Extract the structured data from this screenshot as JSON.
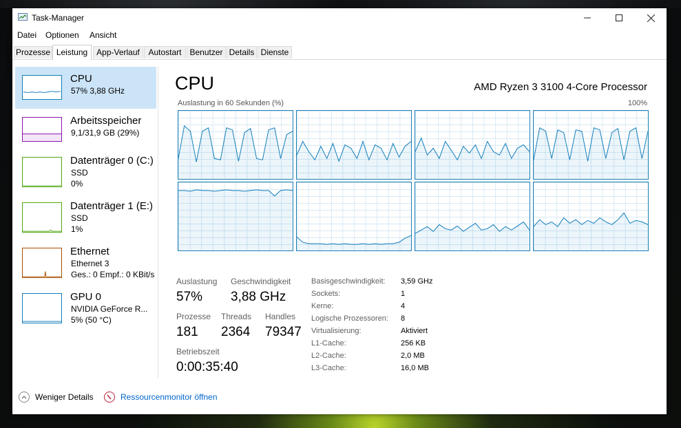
{
  "window": {
    "title": "Task-Manager"
  },
  "menu": [
    "Datei",
    "Optionen",
    "Ansicht"
  ],
  "tabs": [
    "Prozesse",
    "Leistung",
    "App-Verlauf",
    "Autostart",
    "Benutzer",
    "Details",
    "Dienste"
  ],
  "active_tab": "Leistung",
  "sidebar": [
    {
      "title": "CPU",
      "sub1": "57%  3,88 GHz",
      "sub2": "",
      "color": "#117dbb",
      "selected": true
    },
    {
      "title": "Arbeitsspeicher",
      "sub1": "9,1/31,9 GB (29%)",
      "sub2": "",
      "color": "#8b12ae",
      "selected": false
    },
    {
      "title": "Datenträger 0 (C:)",
      "sub1": "SSD",
      "sub2": "0%",
      "color": "#4da60c",
      "selected": false
    },
    {
      "title": "Datenträger 1 (E:)",
      "sub1": "SSD",
      "sub2": "1%",
      "color": "#4da60c",
      "selected": false
    },
    {
      "title": "Ethernet",
      "sub1": "Ethernet 3",
      "sub2": "Ges.: 0  Empf.: 0 KBit/s",
      "color": "#a74f01",
      "selected": false
    },
    {
      "title": "GPU 0",
      "sub1": "NVIDIA GeForce R...",
      "sub2": "5%  (50 °C)",
      "color": "#117dbb",
      "selected": false
    }
  ],
  "main": {
    "title": "CPU",
    "model": "AMD Ryzen 3 3100 4-Core Processor",
    "axis_label": "Auslastung in 60 Sekunden (%)",
    "axis_max": "100%"
  },
  "core_utilization_percent": [
    [
      30,
      78,
      70,
      25,
      70,
      75,
      30,
      28,
      75,
      72,
      26,
      68,
      74,
      30,
      28,
      72,
      75,
      30,
      65,
      70
    ],
    [
      35,
      55,
      40,
      28,
      48,
      30,
      52,
      26,
      50,
      45,
      30,
      55,
      28,
      50,
      45,
      28,
      52,
      32,
      48,
      55
    ],
    [
      40,
      60,
      35,
      45,
      30,
      55,
      42,
      28,
      48,
      38,
      50,
      30,
      55,
      40,
      35,
      52,
      30,
      45,
      50,
      40
    ],
    [
      28,
      75,
      70,
      30,
      72,
      68,
      28,
      72,
      70,
      26,
      75,
      72,
      30,
      68,
      74,
      28,
      70,
      75,
      30,
      70
    ],
    [
      88,
      88,
      87,
      89,
      88,
      88,
      87,
      88,
      89,
      88,
      88,
      87,
      88,
      89,
      88,
      88,
      80,
      88,
      89,
      88
    ],
    [
      20,
      12,
      10,
      10,
      10,
      9,
      10,
      9,
      10,
      9,
      9,
      10,
      9,
      10,
      9,
      10,
      10,
      12,
      18,
      22
    ],
    [
      25,
      30,
      35,
      28,
      38,
      32,
      30,
      36,
      28,
      34,
      40,
      30,
      32,
      38,
      28,
      35,
      30,
      36,
      42,
      30
    ],
    [
      35,
      45,
      38,
      42,
      35,
      48,
      40,
      45,
      38,
      44,
      40,
      48,
      42,
      38,
      45,
      55,
      40,
      44,
      42,
      38
    ]
  ],
  "stats": {
    "auslastung_label": "Auslastung",
    "auslastung": "57%",
    "geschw_label": "Geschwindigkeit",
    "geschw": "3,88 GHz",
    "prozesse_label": "Prozesse",
    "prozesse": "181",
    "threads_label": "Threads",
    "threads": "2364",
    "handles_label": "Handles",
    "handles": "79347",
    "betrieb_label": "Betriebszeit",
    "betrieb": "0:00:35:40"
  },
  "details": [
    {
      "label": "Basisgeschwindigkeit:",
      "value": "3,59 GHz"
    },
    {
      "label": "Sockets:",
      "value": "1"
    },
    {
      "label": "Kerne:",
      "value": "4"
    },
    {
      "label": "Logische Prozessoren:",
      "value": "8"
    },
    {
      "label": "Virtualisierung:",
      "value": "Aktiviert"
    },
    {
      "label": "L1-Cache:",
      "value": "256 KB"
    },
    {
      "label": "L2-Cache:",
      "value": "2,0 MB"
    },
    {
      "label": "L3-Cache:",
      "value": "16,0 MB"
    }
  ],
  "footer": {
    "less_details": "Weniger Details",
    "resource_monitor": "Ressourcenmonitor öffnen"
  },
  "colors": {
    "accent": "#117dbb",
    "link": "#0066cc",
    "selected_bg": "#cce4f7"
  }
}
